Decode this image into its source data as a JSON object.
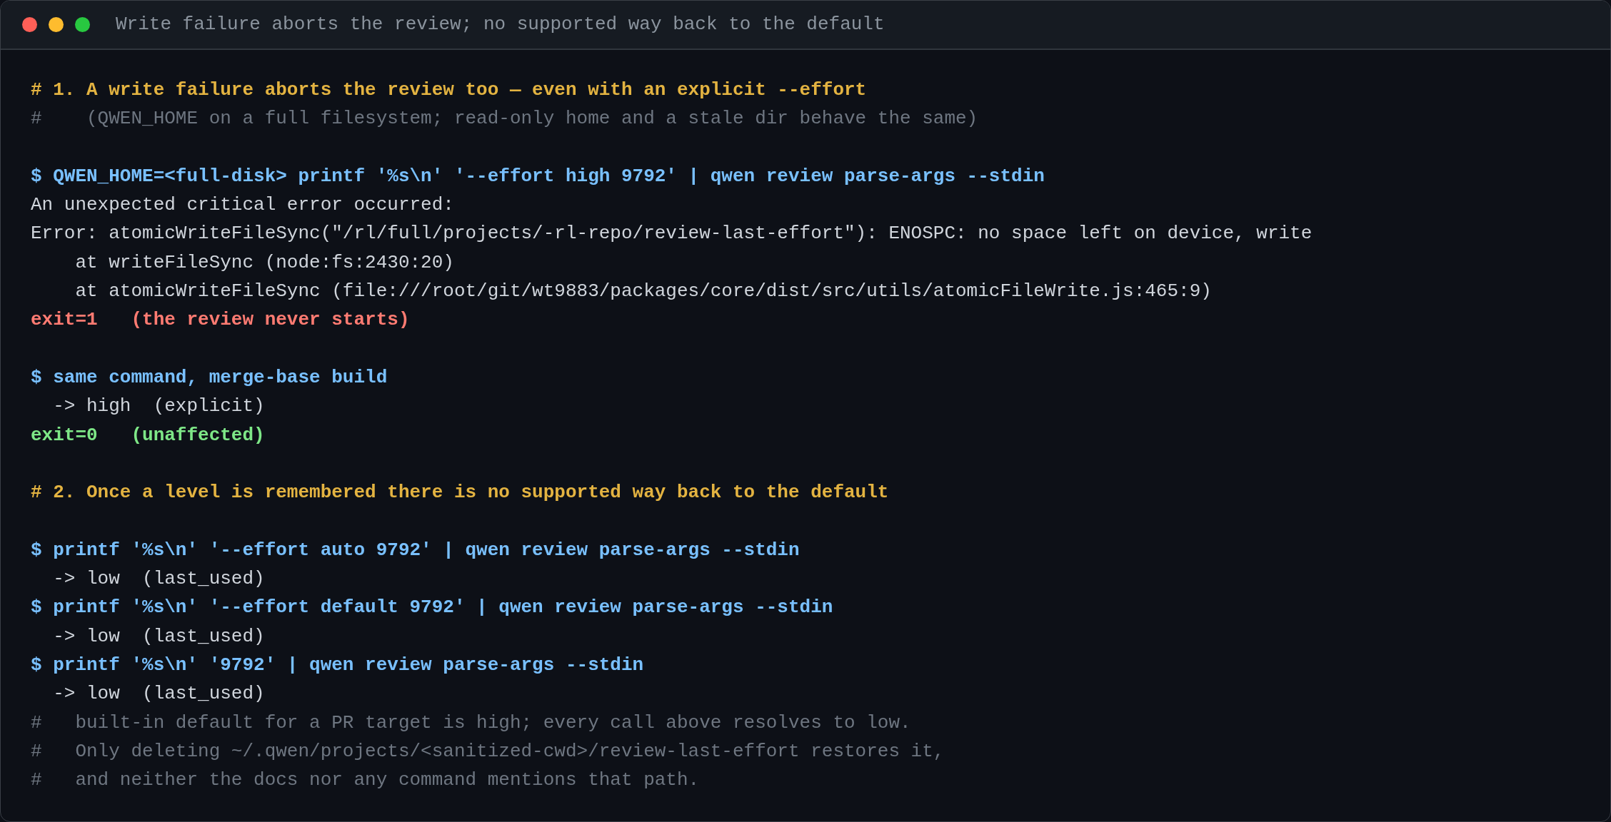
{
  "window": {
    "title": "Write failure aborts the review; no supported way back to the default"
  },
  "lines": [
    {
      "kind": "heading",
      "text": "# 1. A write failure aborts the review too — even with an explicit --effort"
    },
    {
      "kind": "comment",
      "text": "#    (QWEN_HOME on a full filesystem; read-only home and a stale dir behave the same)"
    },
    {
      "kind": "blank"
    },
    {
      "kind": "command",
      "text": "$ QWEN_HOME=<full-disk> printf '%s\\n' '--effort high 9792' | qwen review parse-args --stdin"
    },
    {
      "kind": "output",
      "text": "An unexpected critical error occurred:"
    },
    {
      "kind": "output",
      "text": "Error: atomicWriteFileSync(\"/rl/full/projects/-rl-repo/review-last-effort\"): ENOSPC: no space left on device, write"
    },
    {
      "kind": "output",
      "text": "    at writeFileSync (node:fs:2430:20)"
    },
    {
      "kind": "output",
      "text": "    at atomicWriteFileSync (file:///root/git/wt9883/packages/core/dist/src/utils/atomicFileWrite.js:465:9)"
    },
    {
      "kind": "exit",
      "color": "#ff7b72",
      "text": "exit=1   (the review never starts)"
    },
    {
      "kind": "blank"
    },
    {
      "kind": "command",
      "text": "$ same command, merge-base build"
    },
    {
      "kind": "output",
      "text": "  -> high  (explicit)"
    },
    {
      "kind": "exit",
      "color": "#7ee787",
      "text": "exit=0   (unaffected)"
    },
    {
      "kind": "blank"
    },
    {
      "kind": "heading",
      "text": "# 2. Once a level is remembered there is no supported way back to the default"
    },
    {
      "kind": "blank"
    },
    {
      "kind": "command",
      "text": "$ printf '%s\\n' '--effort auto 9792' | qwen review parse-args --stdin"
    },
    {
      "kind": "output",
      "text": "  -> low  (last_used)"
    },
    {
      "kind": "command",
      "text": "$ printf '%s\\n' '--effort default 9792' | qwen review parse-args --stdin"
    },
    {
      "kind": "output",
      "text": "  -> low  (last_used)"
    },
    {
      "kind": "command",
      "text": "$ printf '%s\\n' '9792' | qwen review parse-args --stdin"
    },
    {
      "kind": "output",
      "text": "  -> low  (last_used)"
    },
    {
      "kind": "comment",
      "text": "#   built-in default for a PR target is high; every call above resolves to low."
    },
    {
      "kind": "comment",
      "text": "#   Only deleting ~/.qwen/projects/<sanitized-cwd>/review-last-effort restores it,"
    },
    {
      "kind": "comment",
      "text": "#   and neither the docs nor any command mentions that path."
    }
  ]
}
